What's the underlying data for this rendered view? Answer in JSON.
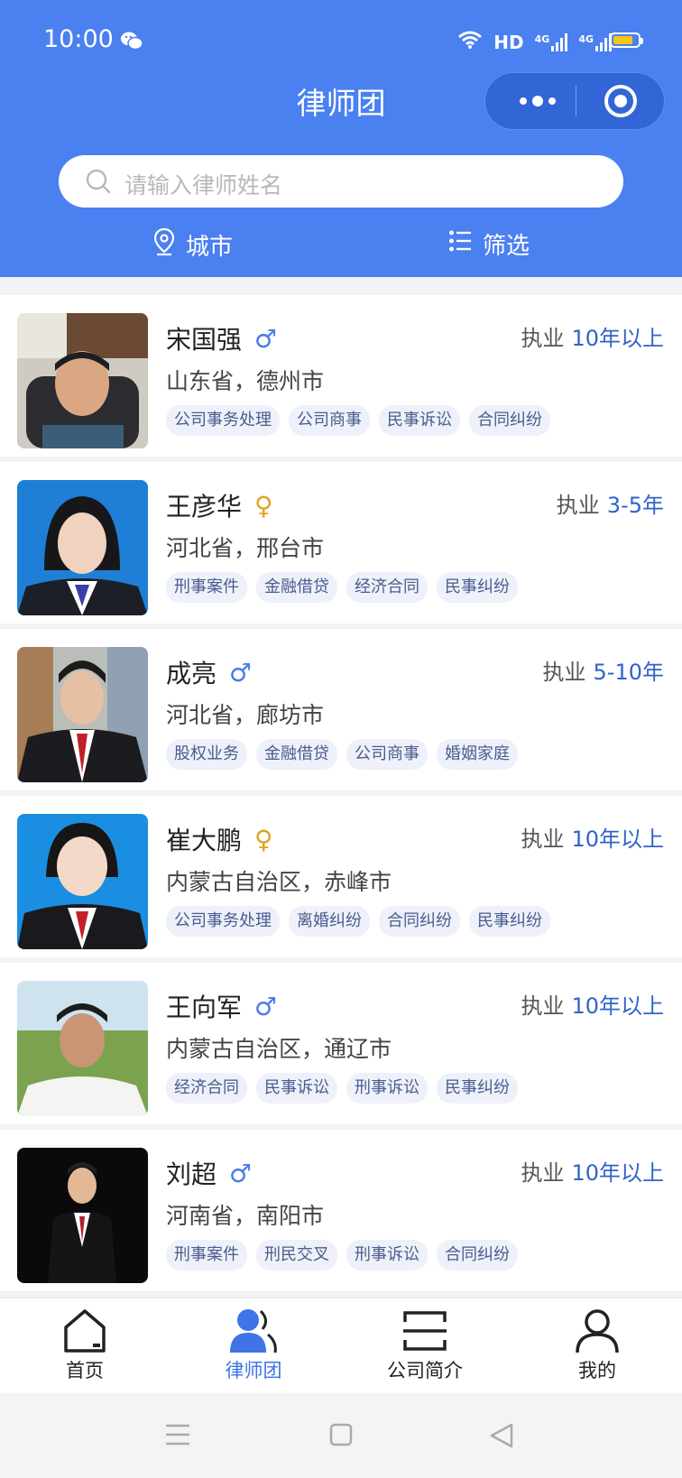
{
  "status_bar": {
    "time": "10:00",
    "network": "HD",
    "sim1": "4G",
    "sim2": "4G"
  },
  "header": {
    "title": "律师团"
  },
  "search": {
    "placeholder": "请输入律师姓名"
  },
  "filters": {
    "city_label": "城市",
    "filter_label": "筛选"
  },
  "practice_label": "执业",
  "lawyers": [
    {
      "name": "宋国强",
      "gender": "male",
      "gender_symbol": "♂",
      "years": "10年以上",
      "location": "山东省，德州市",
      "tags": [
        "公司事务处理",
        "公司商事",
        "民事诉讼",
        "合同纠纷"
      ]
    },
    {
      "name": "王彦华",
      "gender": "female",
      "gender_symbol": "♀",
      "years": "3-5年",
      "location": "河北省，邢台市",
      "tags": [
        "刑事案件",
        "金融借贷",
        "经济合同",
        "民事纠纷"
      ]
    },
    {
      "name": "成亮",
      "gender": "male",
      "gender_symbol": "♂",
      "years": "5-10年",
      "location": "河北省，廊坊市",
      "tags": [
        "股权业务",
        "金融借贷",
        "公司商事",
        "婚姻家庭"
      ]
    },
    {
      "name": "崔大鹏",
      "gender": "female",
      "gender_symbol": "♀",
      "years": "10年以上",
      "location": "内蒙古自治区，赤峰市",
      "tags": [
        "公司事务处理",
        "离婚纠纷",
        "合同纠纷",
        "民事纠纷"
      ]
    },
    {
      "name": "王向军",
      "gender": "male",
      "gender_symbol": "♂",
      "years": "10年以上",
      "location": "内蒙古自治区，通辽市",
      "tags": [
        "经济合同",
        "民事诉讼",
        "刑事诉讼",
        "民事纠纷"
      ]
    },
    {
      "name": "刘超",
      "gender": "male",
      "gender_symbol": "♂",
      "years": "10年以上",
      "location": "河南省，南阳市",
      "tags": [
        "刑事案件",
        "刑民交叉",
        "刑事诉讼",
        "合同纠纷"
      ]
    }
  ],
  "tabbar": {
    "items": [
      {
        "label": "首页",
        "icon": "home-icon",
        "active": false
      },
      {
        "label": "律师团",
        "icon": "lawyers-icon",
        "active": true
      },
      {
        "label": "公司简介",
        "icon": "company-icon",
        "active": false
      },
      {
        "label": "我的",
        "icon": "profile-icon",
        "active": false
      }
    ]
  },
  "colors": {
    "primary": "#4a80f0",
    "active_tab": "#3f74e6",
    "years": "#3163c9",
    "male": "#4a7ce8",
    "female": "#e0a322"
  }
}
